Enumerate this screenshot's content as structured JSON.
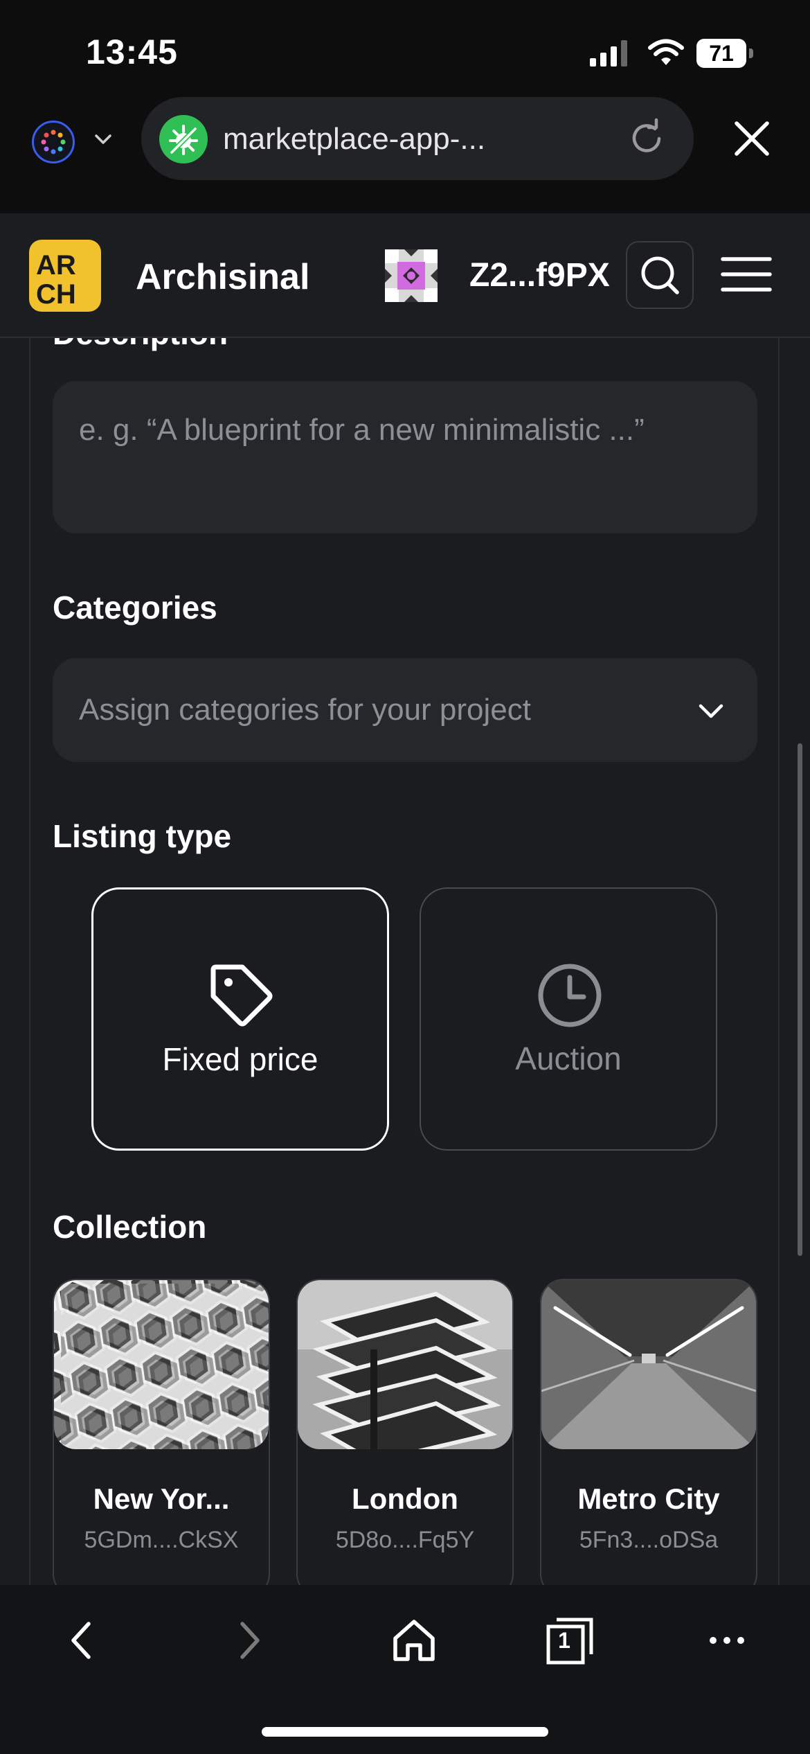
{
  "status_bar": {
    "time": "13:45",
    "battery": "71"
  },
  "browser": {
    "url": "marketplace-app-..."
  },
  "header": {
    "brand": "Archisinal",
    "logo_text": "ARCH",
    "wallet_short": "Z2...f9PX"
  },
  "form": {
    "description_label": "Description",
    "description_placeholder": "e. g. “A blueprint for a new minimalistic ...”",
    "categories_label": "Categories",
    "categories_placeholder": "Assign categories for your project",
    "listing_type_label": "Listing type",
    "listing_options": [
      {
        "label": "Fixed price",
        "icon": "tag-icon",
        "selected": true
      },
      {
        "label": "Auction",
        "icon": "clock-icon",
        "selected": false
      }
    ],
    "collection_label": "Collection",
    "collections": [
      {
        "name": "New Yor...",
        "address": "5GDm....CkSX"
      },
      {
        "name": "London",
        "address": "5D8o....Fq5Y"
      },
      {
        "name": "Metro City",
        "address": "5Fn3....oDSa"
      }
    ]
  },
  "toolbar": {
    "tab_count": "1"
  },
  "colors": {
    "background": "#1a1c1f",
    "logo": "#f2c12e",
    "site_icon": "#2fbf55",
    "avatar_accent": "#d36be0"
  }
}
